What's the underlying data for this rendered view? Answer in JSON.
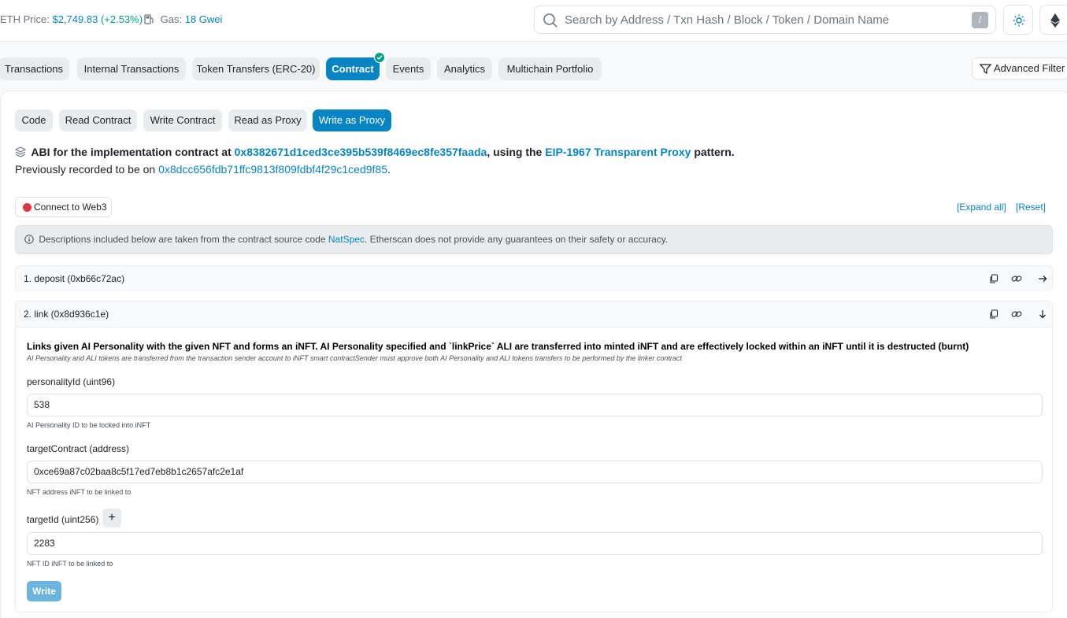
{
  "header": {
    "eth_price_label": "ETH Price:",
    "eth_price_value": "$2,749.83",
    "eth_price_change": "(+2.53%)",
    "gas_label": "Gas:",
    "gas_value": "18 Gwei",
    "search_placeholder": "Search by Address / Txn Hash / Block / Token / Domain Name",
    "search_shortcut": "/"
  },
  "tabs": [
    {
      "label": "Transactions"
    },
    {
      "label": "Internal Transactions"
    },
    {
      "label": "Token Transfers (ERC-20)"
    },
    {
      "label": "Contract"
    },
    {
      "label": "Events"
    },
    {
      "label": "Analytics"
    },
    {
      "label": "Multichain Portfolio"
    }
  ],
  "advanced_filter_label": "Advanced Filter",
  "subtabs": [
    {
      "label": "Code"
    },
    {
      "label": "Read Contract"
    },
    {
      "label": "Write Contract"
    },
    {
      "label": "Read as Proxy"
    },
    {
      "label": "Write as Proxy"
    }
  ],
  "abi": {
    "prefix": "ABI for the implementation contract at",
    "impl_address": "0x8382671d1ced3ce395b539f8469ec8fe357faada",
    "middle": ", using the",
    "pattern_link": "EIP-1967 Transparent Proxy",
    "suffix": "pattern."
  },
  "previous": {
    "prefix": "Previously recorded to be on",
    "address": "0x8dcc656fdb71ffc9813f809fdbf4f29c1ced9f85",
    "suffix": "."
  },
  "connect_label": "Connect to Web3",
  "expand_all_label": "[Expand all]",
  "reset_label": "[Reset]",
  "notice": {
    "prefix": "Descriptions included below are taken from the contract source code",
    "link": "NatSpec",
    "suffix": ". Etherscan does not provide any guarantees on their safety or accuracy."
  },
  "functions": [
    {
      "title": "1. deposit (0xb66c72ac)"
    },
    {
      "title": "2. link (0x8d936c1e)",
      "description": "Links given AI Personality with the given NFT and forms an iNFT. AI Personality specified and `linkPrice` ALI are transferred into minted iNFT and are effectively locked within an iNFT until it is destructed (burnt)",
      "details": "AI Personality and ALI tokens are transferred from the transaction sender account to iNFT smart contractSender must approve both AI Personality and ALI tokens transfers to be performed by the linker contract",
      "params": [
        {
          "label": "personalityId (uint96)",
          "value": "538",
          "help": "AI Personality ID to be locked into iNFT"
        },
        {
          "label": "targetContract (address)",
          "value": "0xce69a87c02baa8c5f17ed7eb8b1c2657afc2e1af",
          "help": "NFT address iNFT to be linked to"
        },
        {
          "label": "targetId (uint256)",
          "value": "2283",
          "help": "NFT ID iNFT to be linked to"
        }
      ],
      "plus_label": "+",
      "write_label": "Write"
    }
  ],
  "colors": {
    "accent": "#0784c3",
    "positive": "#00a186",
    "danger": "#dc3545"
  }
}
